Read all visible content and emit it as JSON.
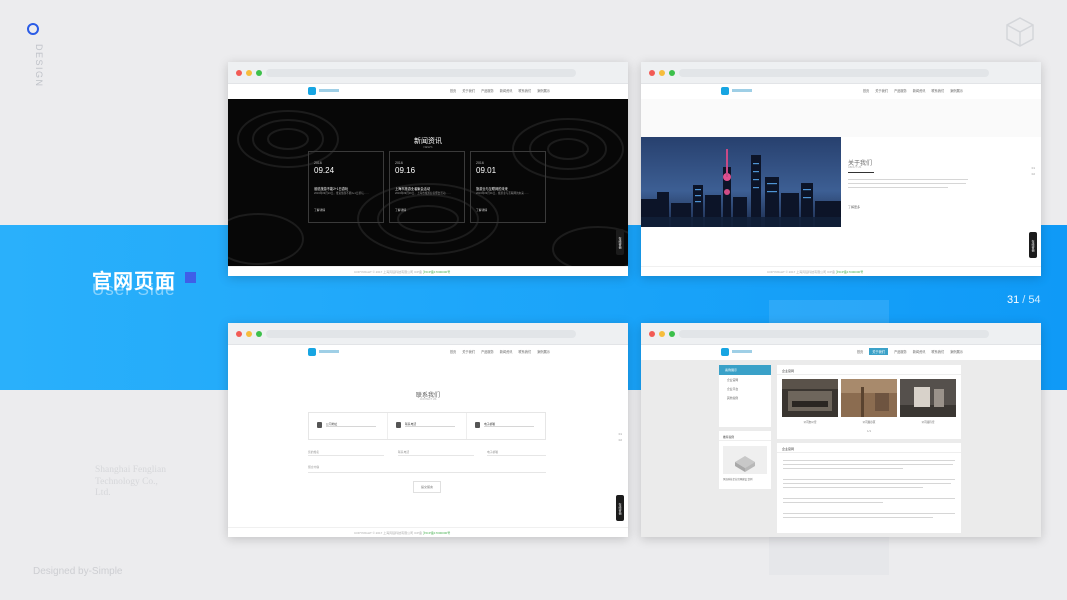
{
  "slide": {
    "side_label": "DESIGN",
    "section_title": "官网页面",
    "section_subtitle": "User Side",
    "page_current": "31",
    "page_separator": "/",
    "page_total": "54",
    "company_name": "Shanghai Fenglian Technology Co., Ltd.",
    "credit": "Designed by-Simple",
    "accent_color": "#19a3f9"
  },
  "site": {
    "nav": [
      "首页",
      "关于我们",
      "产品服务",
      "新闻资讯",
      "联系我们",
      "案例展示"
    ],
    "float_contact": "在线咨询",
    "copyright": "COPYRIGHT © 2017 上海风链科技有限公司 ICP备",
    "copyright_link": "沪ICP备17000000号"
  },
  "news": {
    "title": "新闻资讯",
    "subtitle": "NEWS",
    "items": [
      {
        "year": "2016",
        "date": "09.24",
        "headline": "谁说旅游不能2+1日游玩",
        "excerpt": "2016年09月24日，谁说旅游不能2+1日游玩……",
        "more": "了解详情"
      },
      {
        "year": "2016",
        "date": "09.16",
        "headline": "上海市旅游业者聚会活动",
        "excerpt": "2016年09月16日，上海市旅游业者聚会活动……",
        "more": "了解详情"
      },
      {
        "year": "2016",
        "date": "09.01",
        "headline": "旅游业与互联网的未来",
        "excerpt": "2016年09月01日，旅游业与互联网的未来……",
        "more": "了解详情"
      }
    ]
  },
  "about": {
    "title": "关于我们",
    "subtitle": "ABOUT US",
    "more": "了解更多",
    "side_nums": [
      "01",
      "02"
    ]
  },
  "contact": {
    "title": "联系我们",
    "subtitle": "CONTACT US",
    "cells": [
      {
        "icon": "location-icon",
        "label": "公司地址"
      },
      {
        "icon": "phone-icon",
        "label": "联系电话"
      },
      {
        "icon": "mail-icon",
        "label": "电子邮箱"
      }
    ],
    "fields": [
      "您的姓名",
      "联系电话",
      "电子邮箱"
    ],
    "message_label": "留言内容",
    "submit": "提交留言"
  },
  "case": {
    "side_header": "案例展示",
    "side_items": [
      "企业官网",
      "企业平台",
      "其他案例"
    ],
    "hot_header": "推荐案例",
    "hot_caption": "风链科技企业官网建设 案例",
    "main_header": "企业官网",
    "captions": [
      "公司办公室",
      "公司展示区",
      "公司接待室"
    ],
    "pager": "1/1",
    "text_header": "企业官网"
  }
}
